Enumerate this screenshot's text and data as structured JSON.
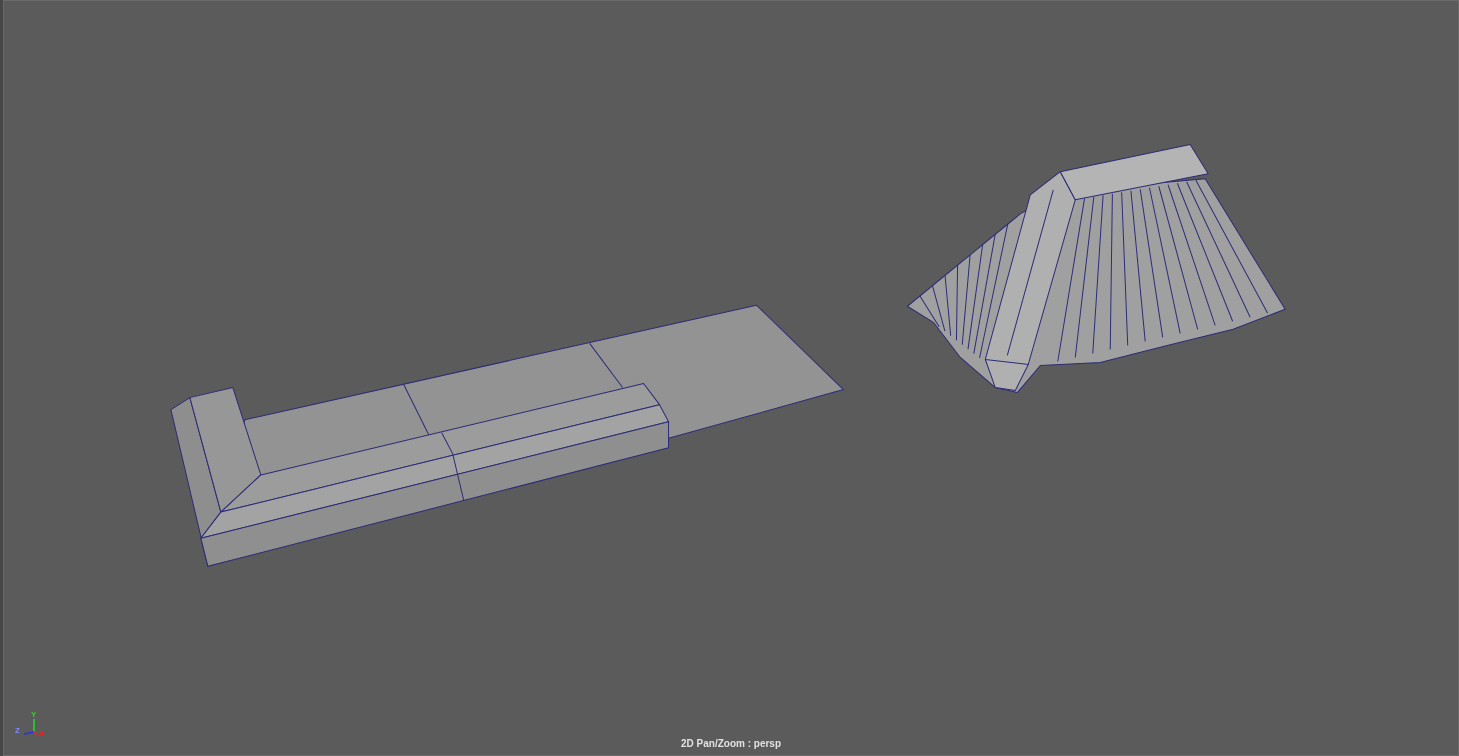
{
  "viewport": {
    "camera_label": "2D Pan/Zoom : persp",
    "axis_gizmo": {
      "y_label": "Y",
      "z_label": "Z",
      "x_label": "X"
    }
  }
}
